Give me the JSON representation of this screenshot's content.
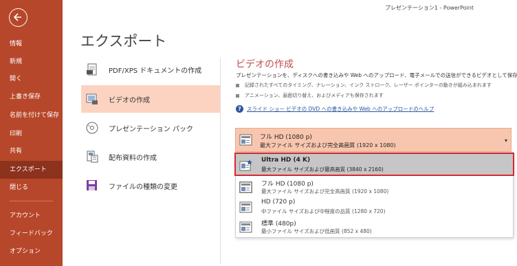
{
  "window": {
    "title": "プレゼンテーション1 - PowerPoint"
  },
  "sidebar": {
    "items": [
      {
        "label": "情報"
      },
      {
        "label": "新規"
      },
      {
        "label": "開く"
      },
      {
        "label": "上書き保存"
      },
      {
        "label": "名前を付けて保存"
      },
      {
        "label": "印刷"
      },
      {
        "label": "共有"
      },
      {
        "label": "エクスポート",
        "active": true
      },
      {
        "label": "閉じる"
      },
      {
        "label": "アカウント"
      },
      {
        "label": "フィードバック"
      },
      {
        "label": "オプション"
      }
    ]
  },
  "page": {
    "title": "エクスポート"
  },
  "export_options": [
    {
      "label": "PDF/XPS ドキュメントの作成",
      "icon": "pdf-document-icon"
    },
    {
      "label": "ビデオの作成",
      "icon": "video-icon",
      "active": true
    },
    {
      "label": "プレゼンテーション パック",
      "icon": "disc-package-icon"
    },
    {
      "label": "配布資料の作成",
      "icon": "handout-icon"
    },
    {
      "label": "ファイルの種類の変更",
      "icon": "save-file-type-icon"
    }
  ],
  "video": {
    "title": "ビデオの作成",
    "description": "プレゼンテーションを、ディスクへの書き込みや Web へのアップロード、電子メールでの送信ができるビデオとして保存します。",
    "bullets": [
      "記録されたすべてのタイミング、ナレーション、インク ストローク、レーザー ポインターの動きが組み込まれます",
      "アニメーション、画面切り替え、およびメディアも保存されます"
    ],
    "help_link": "スライド ショー ビデオの DVD への書き込みや Web へのアップロードのヘルプ",
    "dropdown": {
      "selected_title": "フル HD (1080 p)",
      "selected_sub": "最大ファイル サイズおよび完全高画質 (1920 x 1080)"
    },
    "menu": [
      {
        "title": "Ultra HD (4 K)",
        "sub": "最大ファイル サイズおよび最高画質 (3840 x 2160)",
        "state": "selected"
      },
      {
        "title": "フル HD (1080 p)",
        "sub": "最大ファイル サイズおよび完全高画質 (1920 x 1080)",
        "state": "hovered"
      },
      {
        "title": "HD (720 p)",
        "sub": "中ファイル サイズおよび中程度の品質 (1280 x 720)",
        "state": "normal"
      },
      {
        "title": "標準 (480p)",
        "sub": "最小ファイル サイズおよび低画質 (852 x 480)",
        "state": "normal"
      }
    ]
  },
  "colors": {
    "sidebar": "#b7472a",
    "sidebar_active": "#8c321d",
    "option_active": "#fcd3c1",
    "accent_title": "#c0504d",
    "dropdown": "#f8c6ae",
    "highlight_border": "#d9272e",
    "link": "#2b579a"
  }
}
